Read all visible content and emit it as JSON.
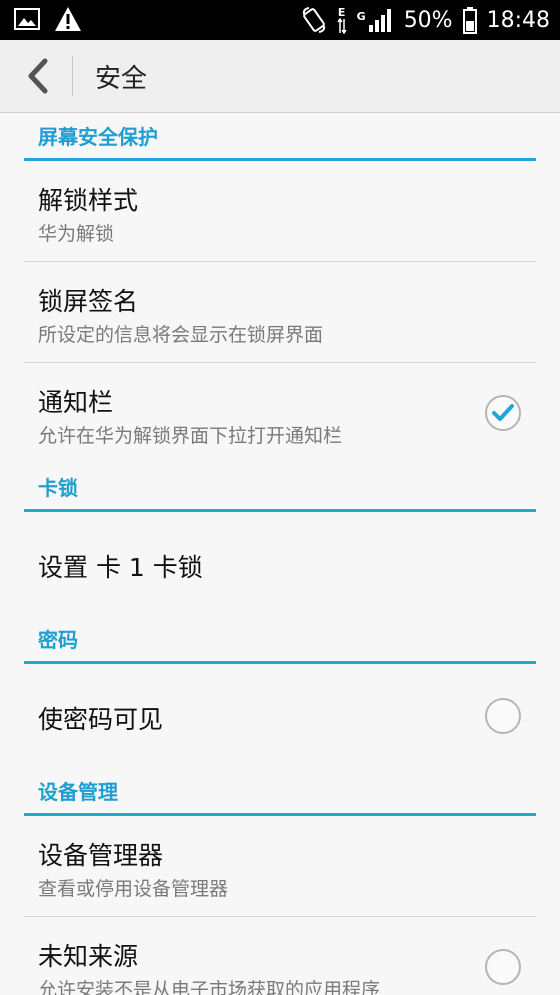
{
  "status_bar": {
    "battery": "50%",
    "time": "18:48",
    "net_tag_1": "E",
    "net_tag_2": "G",
    "icons": [
      "image-icon",
      "warning-icon",
      "rotate-icon",
      "signal-icon",
      "battery-icon"
    ]
  },
  "action_bar": {
    "title": "安全",
    "back_icon": "chevron-left-icon"
  },
  "sections": {
    "screen": {
      "header": "屏幕安全保护",
      "unlock_style": {
        "title": "解锁样式",
        "summary": "华为解锁"
      },
      "lock_signature": {
        "title": "锁屏签名",
        "summary": "所设定的信息将会显示在锁屏界面"
      },
      "notification_bar": {
        "title": "通知栏",
        "summary": "允许在华为解锁界面下拉打开通知栏",
        "checked": true
      }
    },
    "sim_lock": {
      "header": "卡锁",
      "set_sim_lock": {
        "title": "设置 卡 1 卡锁"
      }
    },
    "password": {
      "header": "密码",
      "show_password": {
        "title": "使密码可见",
        "checked": false
      }
    },
    "device_admin": {
      "header": "设备管理",
      "device_admins": {
        "title": "设备管理器",
        "summary": "查看或停用设备管理器"
      },
      "unknown_sources": {
        "title": "未知来源",
        "summary": "允许安装不是从电子市场获取的应用程序",
        "checked": false
      }
    }
  },
  "colors": {
    "accent": "#1f9ed1",
    "divider": "#23a5d6",
    "status_bar": "#000000"
  }
}
